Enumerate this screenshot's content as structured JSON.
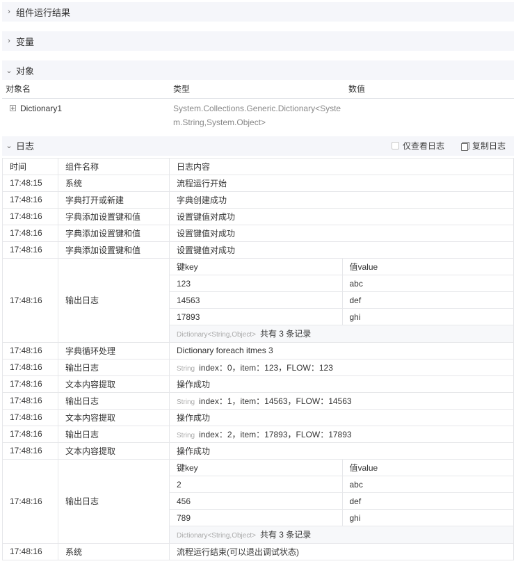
{
  "sections": {
    "result": {
      "title": "组件运行结果",
      "chev": "›"
    },
    "variables": {
      "title": "变量",
      "chev": "›"
    },
    "objects": {
      "title": "对象",
      "chev": "⌄"
    },
    "logs": {
      "title": "日志",
      "chev": "⌄",
      "only_logs_label": "仅查看日志",
      "copy_label": "复制日志"
    }
  },
  "objects_table": {
    "headers": {
      "name": "对象名",
      "type": "类型",
      "value": "数值"
    },
    "rows": [
      {
        "name": "Dictionary1",
        "type_line1": "System.Collections.Generic.Dictionary<Syste",
        "type_line2": "m.String,System.Object>",
        "value": ""
      }
    ]
  },
  "logs_table": {
    "headers": {
      "time": "时间",
      "name": "组件名称",
      "content": "日志内容"
    },
    "rows": [
      {
        "time": "17:48:15",
        "name": "系统",
        "content": "流程运行开始"
      },
      {
        "time": "17:48:16",
        "name": "字典打开或新建",
        "content": "字典创建成功"
      },
      {
        "time": "17:48:16",
        "name": "字典添加设置键和值",
        "content": "设置键值对成功"
      },
      {
        "time": "17:48:16",
        "name": "字典添加设置键和值",
        "content": "设置键值对成功"
      },
      {
        "time": "17:48:16",
        "name": "字典添加设置键和值",
        "content": "设置键值对成功"
      }
    ],
    "dict1": {
      "time": "17:48:16",
      "name": "输出日志",
      "key_header": "键key",
      "value_header": "值value",
      "entries": [
        {
          "key": "123",
          "value": "abc"
        },
        {
          "key": "14563",
          "value": "def"
        },
        {
          "key": "17893",
          "value": "ghi"
        }
      ],
      "footer_type": "Dictionary<String,Object>",
      "footer_count": "共有 3 条记录"
    },
    "rows2": [
      {
        "time": "17:48:16",
        "name": "字典循环处理",
        "tag": "",
        "content": "Dictionary foreach itmes 3"
      },
      {
        "time": "17:48:16",
        "name": "输出日志",
        "tag": "String",
        "content": "index：0，item：123，FLOW：123"
      },
      {
        "time": "17:48:16",
        "name": "文本内容提取",
        "tag": "",
        "content": "操作成功"
      },
      {
        "time": "17:48:16",
        "name": "输出日志",
        "tag": "String",
        "content": "index：1，item：14563，FLOW：14563"
      },
      {
        "time": "17:48:16",
        "name": "文本内容提取",
        "tag": "",
        "content": "操作成功"
      },
      {
        "time": "17:48:16",
        "name": "输出日志",
        "tag": "String",
        "content": "index：2，item：17893，FLOW：17893"
      },
      {
        "time": "17:48:16",
        "name": "文本内容提取",
        "tag": "",
        "content": "操作成功"
      }
    ],
    "dict2": {
      "time": "17:48:16",
      "name": "输出日志",
      "key_header": "键key",
      "value_header": "值value",
      "entries": [
        {
          "key": "2",
          "value": "abc"
        },
        {
          "key": "456",
          "value": "def"
        },
        {
          "key": "789",
          "value": "ghi"
        }
      ],
      "footer_type": "Dictionary<String,Object>",
      "footer_count": "共有 3 条记录"
    },
    "last": {
      "time": "17:48:16",
      "name": "系统",
      "content": "流程运行结束(可以退出调试状态)"
    }
  }
}
